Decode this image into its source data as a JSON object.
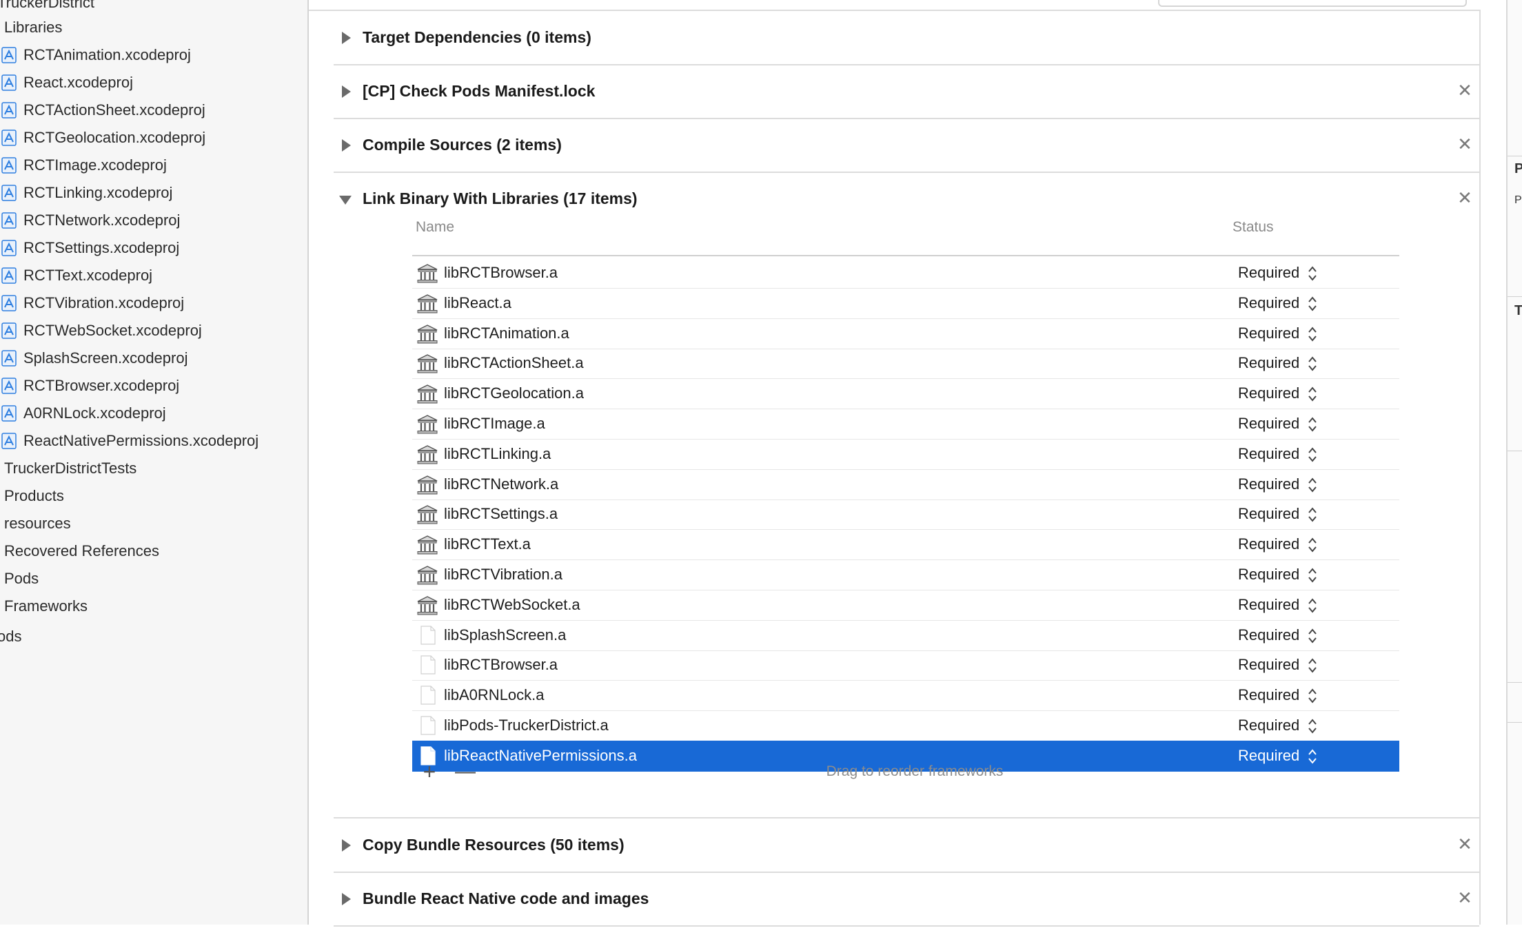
{
  "sidebar": {
    "top_cut": "TruckerDistrict",
    "libraries_group": "Libraries",
    "projects": [
      "RCTAnimation.xcodeproj",
      "React.xcodeproj",
      "RCTActionSheet.xcodeproj",
      "RCTGeolocation.xcodeproj",
      "RCTImage.xcodeproj",
      "RCTLinking.xcodeproj",
      "RCTNetwork.xcodeproj",
      "RCTSettings.xcodeproj",
      "RCTText.xcodeproj",
      "RCTVibration.xcodeproj",
      "RCTWebSocket.xcodeproj",
      "SplashScreen.xcodeproj",
      "RCTBrowser.xcodeproj",
      "A0RNLock.xcodeproj",
      "ReactNativePermissions.xcodeproj"
    ],
    "groups": [
      "TruckerDistrictTests",
      "Products",
      "resources",
      "Recovered References",
      "Pods",
      "Frameworks"
    ],
    "bottom_cut": "ods"
  },
  "phases": {
    "target_dependencies": "Target Dependencies (0 items)",
    "check_pods": "[CP] Check Pods Manifest.lock",
    "compile_sources": "Compile Sources (2 items)",
    "link_binary": "Link Binary With Libraries (17 items)",
    "copy_bundle": "Copy Bundle Resources (50 items)",
    "bundle_react": "Bundle React Native code and images",
    "close_glyph": "✕"
  },
  "library_table": {
    "col_name": "Name",
    "col_status": "Status",
    "rows": [
      {
        "name": "libRCTBrowser.a",
        "status": "Required",
        "icon": "library-icon"
      },
      {
        "name": "libReact.a",
        "status": "Required",
        "icon": "library-icon"
      },
      {
        "name": "libRCTAnimation.a",
        "status": "Required",
        "icon": "library-icon"
      },
      {
        "name": "libRCTActionSheet.a",
        "status": "Required",
        "icon": "library-icon"
      },
      {
        "name": "libRCTGeolocation.a",
        "status": "Required",
        "icon": "library-icon"
      },
      {
        "name": "libRCTImage.a",
        "status": "Required",
        "icon": "library-icon"
      },
      {
        "name": "libRCTLinking.a",
        "status": "Required",
        "icon": "library-icon"
      },
      {
        "name": "libRCTNetwork.a",
        "status": "Required",
        "icon": "library-icon"
      },
      {
        "name": "libRCTSettings.a",
        "status": "Required",
        "icon": "library-icon"
      },
      {
        "name": "libRCTText.a",
        "status": "Required",
        "icon": "library-icon"
      },
      {
        "name": "libRCTVibration.a",
        "status": "Required",
        "icon": "library-icon"
      },
      {
        "name": "libRCTWebSocket.a",
        "status": "Required",
        "icon": "library-icon"
      },
      {
        "name": "libSplashScreen.a",
        "status": "Required",
        "icon": "file-icon"
      },
      {
        "name": "libRCTBrowser.a",
        "status": "Required",
        "icon": "file-icon"
      },
      {
        "name": "libA0RNLock.a",
        "status": "Required",
        "icon": "file-icon"
      },
      {
        "name": "libPods-TruckerDistrict.a",
        "status": "Required",
        "icon": "file-icon"
      },
      {
        "name": "libReactNativePermissions.a",
        "status": "Required",
        "icon": "file-icon",
        "selected": true
      }
    ],
    "add_glyph": "+",
    "remove_glyph": "—",
    "drag_hint": "Drag to reorder frameworks"
  },
  "inspector": {
    "letter_p": "P",
    "letter_t": "T"
  },
  "colors": {
    "selection": "#1869d6",
    "sidebar_bg": "#f6f6f6",
    "project_icon": "#2f7fe0"
  }
}
